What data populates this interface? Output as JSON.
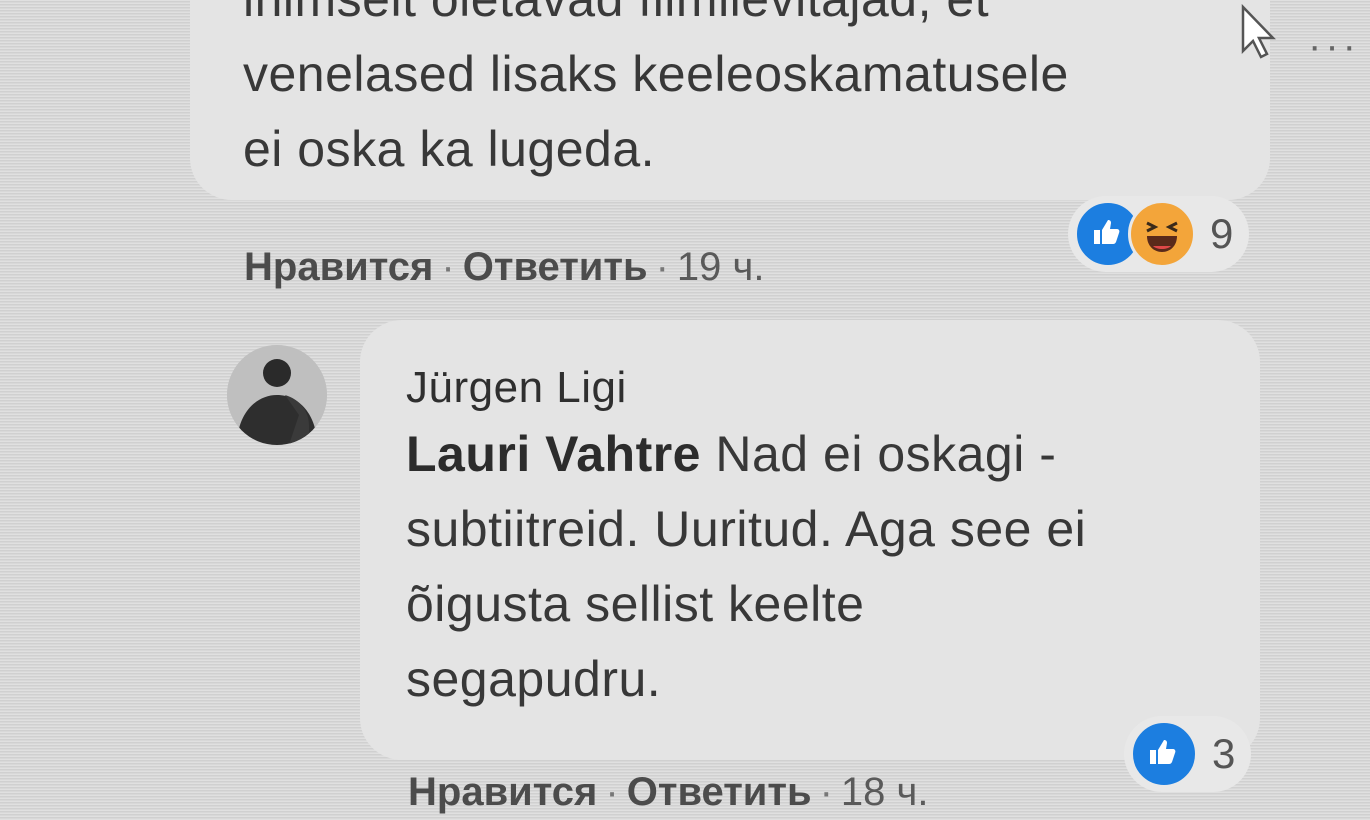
{
  "comment1": {
    "partial_line": "inimselt oletavad filmilevitajad, et",
    "lines": [
      "venelased lisaks keeleoskamatusele",
      "ei oska ka lugeda."
    ],
    "actions": {
      "like": "Нравится",
      "reply": "Ответить",
      "time": "19 ч."
    },
    "separator": "·",
    "reactions": {
      "icons": [
        "like-icon",
        "haha-icon"
      ],
      "count": "9"
    }
  },
  "comment2": {
    "author": "Jürgen Ligi",
    "mention": "Lauri Vahtre",
    "text_first": " Nad ei oskagi -",
    "lines": [
      "subtiitreid. Uuritud. Aga see ei",
      "õigusta sellist keelte",
      "segapudru."
    ],
    "actions": {
      "like": "Нравится",
      "reply": "Ответить",
      "time": "18 ч."
    },
    "separator": "·",
    "reactions": {
      "icons": [
        "like-icon"
      ],
      "count": "3"
    }
  },
  "menu": {
    "more_icon": "···"
  },
  "colors": {
    "like_blue": "#1c7ee0",
    "haha_orange": "#f3a53a",
    "bubble": "#e4e4e4"
  }
}
